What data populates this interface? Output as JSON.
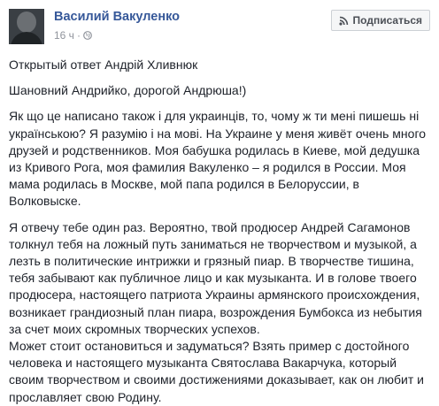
{
  "post": {
    "author": "Василий Вакуленко",
    "time": "16 ч",
    "separator": "·",
    "follow_label": "Подписаться",
    "paragraphs": [
      "Открытый ответ Андрій Хливнюк",
      "Шановний Андрийко, дорогой Андрюша!)",
      "Як що це написано також і для украинцiв, то, чому ж ти мені пишешь ні украïнською? Я разумію і на мові. На Украине у меня живёт очень много друзей и родственников. Моя бабушка родилась в Киеве, мой дедушка из Кривого Рога, моя фамилия Вакуленко – я родился в России. Моя мама родилась в Москве, мой папа родился в Белоруссии, в Волковыске.",
      "Я отвечу тебе один раз. Вероятно, твой продюсер Андрей Сагамонов толкнул тебя на ложный путь заниматься не творчеством и музыкой, а лезть в политические интрижки и грязный пиар. В творчестве тишина, тебя забывают как публичное лицо и как музыканта. И в голове твоего продюсера, настоящего патриота Украины армянского происхождения, возникает грандиозный план пиара, возрождения Бумбокса из небытия за счет моих скромных творческих успехов.",
      "Может стоит остановиться и задуматься? Взять пример с достойного человека и настоящего музыканта Святослава Вакарчука, который своим творчеством и своими достижениями доказывает, как он любит и прославляет свою Родину."
    ]
  },
  "icons": {
    "avatar": "avatar-photo",
    "privacy": "globe-icon",
    "follow": "rss-icon"
  }
}
